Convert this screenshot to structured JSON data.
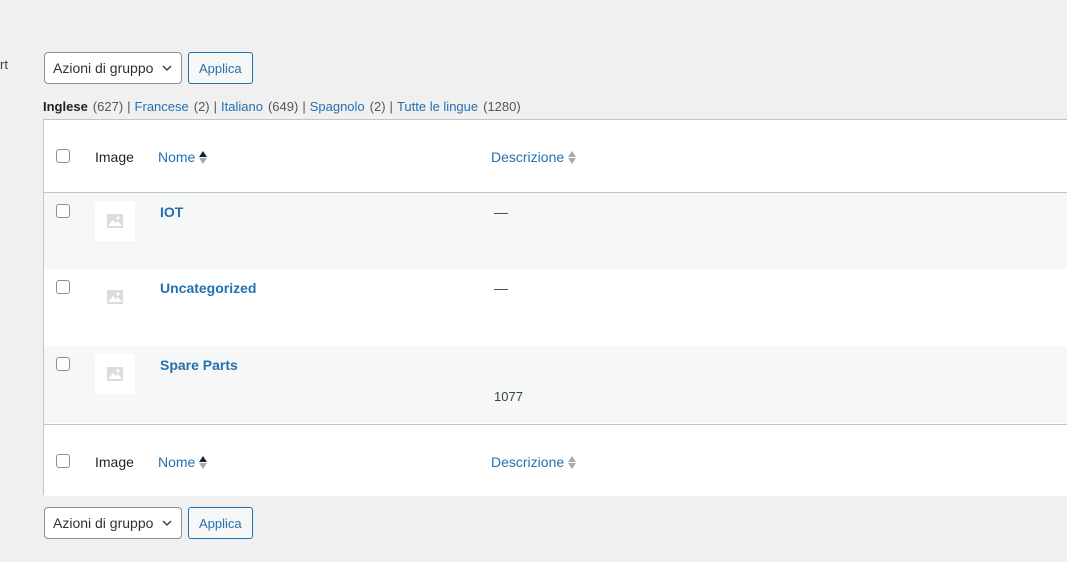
{
  "edge_text": "rt",
  "bulk_actions": {
    "select_value": "Azioni di gruppo",
    "apply_label": "Applica"
  },
  "language_filter": {
    "current": {
      "label": "Inglese",
      "count": "(627)"
    },
    "items": [
      {
        "label": "Francese",
        "count": "(2)"
      },
      {
        "label": "Italiano",
        "count": "(649)"
      },
      {
        "label": "Spagnolo",
        "count": "(2)"
      },
      {
        "label": "Tutte le lingue",
        "count": "(1280)"
      }
    ],
    "separator": "|"
  },
  "table": {
    "columns": {
      "image": "Image",
      "name": "Nome",
      "description": "Descrizione"
    },
    "rows": [
      {
        "name": "IOT",
        "description": "—",
        "count": ""
      },
      {
        "name": "Uncategorized",
        "description": "—",
        "count": ""
      },
      {
        "name": "Spare Parts",
        "description": "",
        "count": "1077"
      }
    ]
  },
  "icons": {
    "placeholder": "image-placeholder-icon",
    "chevron": "chevron-down-icon",
    "sort_active": "sort-ascending-icon",
    "sort_inactive": "sort-neutral-icon"
  },
  "colors": {
    "link": "#2271b1",
    "background": "#f0f0f1",
    "row_alt": "#f6f7f7",
    "border": "#c3c4c7"
  }
}
